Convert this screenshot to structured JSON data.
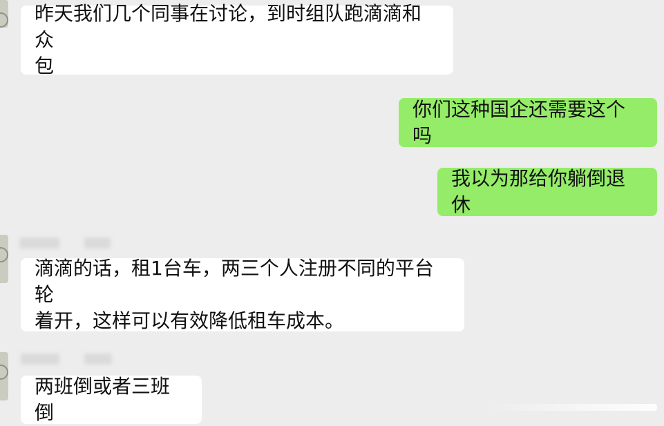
{
  "chat": {
    "messages": [
      {
        "side": "left",
        "text": "昨天我们几个同事在讨论，到时组队跑滴滴和众\n包"
      },
      {
        "side": "right",
        "text": "你们这种国企还需要这个吗"
      },
      {
        "side": "right",
        "text": "我以为那给你躺倒退休"
      },
      {
        "side": "left",
        "text": "滴滴的话，租1台车，两三个人注册不同的平台轮\n着开，这样可以有效降低租车成本。"
      },
      {
        "side": "left",
        "text": "两班倒或者三班倒"
      }
    ]
  },
  "colors": {
    "background": "#ededed",
    "incoming_bubble": "#ffffff",
    "outgoing_bubble": "#95ec69",
    "text": "#111111"
  }
}
